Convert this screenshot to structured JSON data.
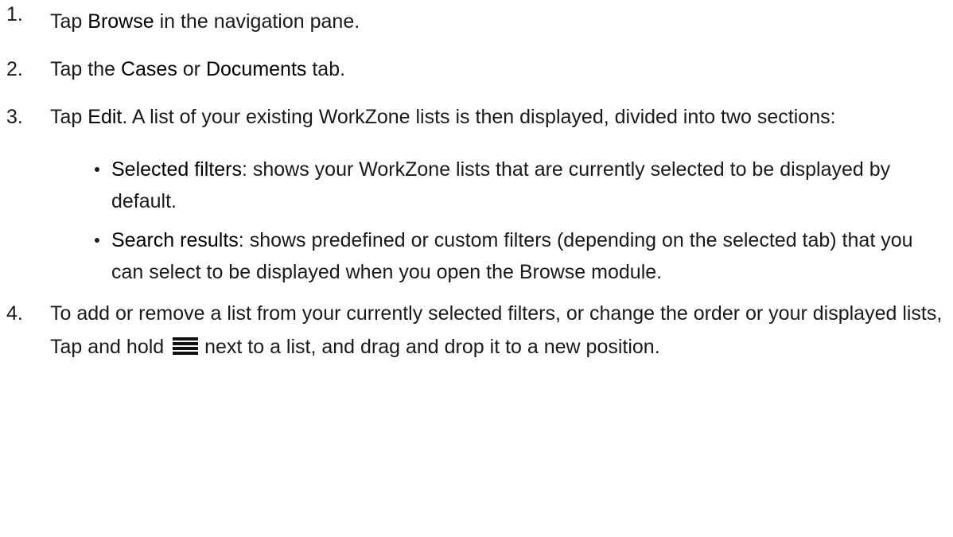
{
  "steps": [
    {
      "number": "1.",
      "pre": "Tap ",
      "keyword": "Browse",
      "post": " in the navigation pane."
    },
    {
      "number": "2.",
      "pre": "Tap the ",
      "keyword1": "Cases",
      "mid": " or ",
      "keyword2": "Documents",
      "post": " tab."
    },
    {
      "number": "3.",
      "pre": "Tap ",
      "keyword": "Edit",
      "post": ". A list of your existing WorkZone lists is then displayed, divided into two sections:",
      "bullets": [
        {
          "keyword": "Selected filters",
          "text": ": shows your WorkZone lists that are currently selected to be displayed by default."
        },
        {
          "keyword": "Search results",
          "text": ": shows predefined or custom filters (depending on the selected tab) that you can select to be displayed when you open the Browse module."
        }
      ]
    },
    {
      "number": "4.",
      "pre": "To add or remove a list from your currently selected filters, or change the order or your displayed lists, Tap and hold ",
      "icon": "drag-handle-icon",
      "post": " next to a list, and drag and drop it to a new position."
    }
  ]
}
